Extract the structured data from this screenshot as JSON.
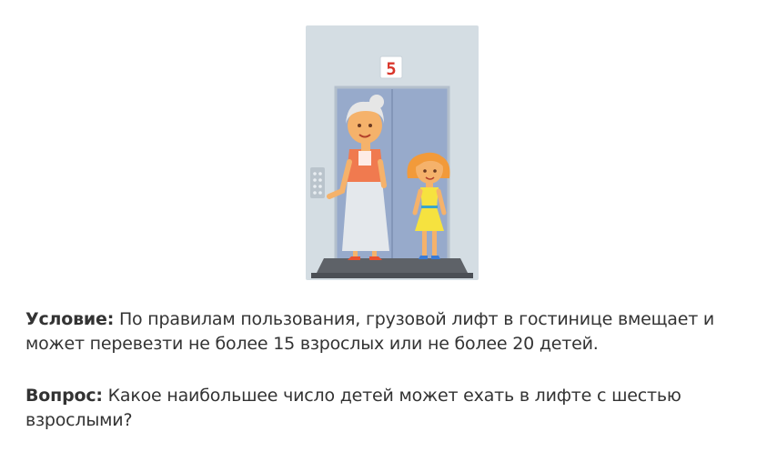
{
  "elevator": {
    "floor_number": "5"
  },
  "condition": {
    "label": "Условие:",
    "text": " По правилам пользования, грузовой лифт в гостинице вмещает и может перевезти не более 15 взрослых или не более 20 детей."
  },
  "question": {
    "label": "Вопрос:",
    "text": " Какое наибольшее число детей может ехать в лифте с шестью взрослыми?"
  },
  "colors": {
    "elevator_frame": "#d4dde3",
    "elevator_door": "#97aacb",
    "floor": "#5e6268",
    "floor_sign": "#d9362b",
    "grandma_shirt": "#f07a4f",
    "grandma_skirt": "#e4e8ec",
    "girl_dress": "#f6e23f",
    "girl_hair": "#f29a3a"
  }
}
